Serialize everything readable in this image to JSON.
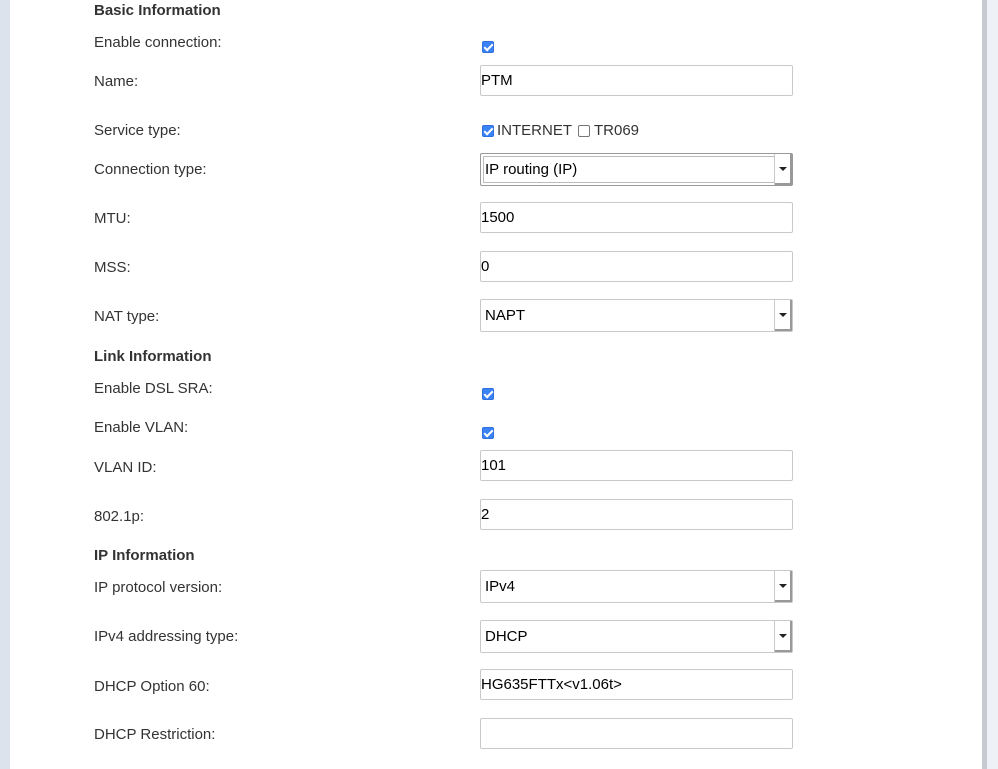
{
  "sections": {
    "basic": "Basic Information",
    "link": "Link Information",
    "ip": "IP Information"
  },
  "fields": {
    "enable_connection": {
      "label": "Enable connection:",
      "checked": true
    },
    "name": {
      "label": "Name:",
      "value": "PTM"
    },
    "service_type": {
      "label": "Service type:",
      "options": [
        {
          "label": "INTERNET",
          "checked": true
        },
        {
          "label": "TR069",
          "checked": false
        }
      ]
    },
    "connection_type": {
      "label": "Connection type:",
      "value": "IP routing (IP)"
    },
    "mtu": {
      "label": "MTU:",
      "value": "1500"
    },
    "mss": {
      "label": "MSS:",
      "value": "0"
    },
    "nat_type": {
      "label": "NAT type:",
      "value": "NAPT"
    },
    "enable_dsl_sra": {
      "label": "Enable DSL SRA:",
      "checked": true
    },
    "enable_vlan": {
      "label": "Enable VLAN:",
      "checked": true
    },
    "vlan_id": {
      "label": "VLAN ID:",
      "value": "101"
    },
    "dot1p": {
      "label": "802.1p:",
      "value": "2"
    },
    "ip_protocol_version": {
      "label": "IP protocol version:",
      "value": "IPv4"
    },
    "ipv4_addressing_type": {
      "label": "IPv4 addressing type:",
      "value": "DHCP"
    },
    "dhcp_option_60": {
      "label": "DHCP Option 60:",
      "value": "HG635FTTx<v1.06t>"
    },
    "dhcp_restriction": {
      "label": "DHCP Restriction:",
      "value": ""
    }
  },
  "colors": {
    "checkbox_on": "#3b82f6",
    "page_bg": "#dde3ec"
  }
}
